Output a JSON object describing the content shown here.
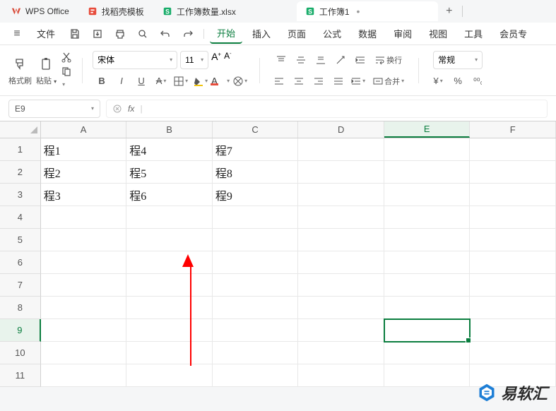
{
  "tabs": {
    "app": "WPS Office",
    "shell": "找稻壳模板",
    "file1": "工作簿数量.xlsx",
    "file2": "工作簿1"
  },
  "menu": {
    "burger": "≡",
    "file": "文件",
    "items": [
      "开始",
      "插入",
      "页面",
      "公式",
      "数据",
      "审阅",
      "视图",
      "工具",
      "会员专"
    ],
    "active": "开始"
  },
  "ribbon": {
    "format_painter": "格式刷",
    "paste": "粘贴",
    "font_name": "宋体",
    "font_size": "11",
    "wrap": "换行",
    "merge": "合并",
    "normal": "常规"
  },
  "name_box": "E9",
  "fx": "fx",
  "columns": [
    "A",
    "B",
    "C",
    "D",
    "E",
    "F"
  ],
  "rows": [
    "1",
    "2",
    "3",
    "4",
    "5",
    "6",
    "7",
    "8",
    "9",
    "10",
    "11"
  ],
  "cells": {
    "A1": "程1",
    "A2": "程2",
    "A3": "程3",
    "B1": "程4",
    "B2": "程5",
    "B3": "程6",
    "C1": "程7",
    "C2": "程8",
    "C3": "程9"
  },
  "selected_cell": "E9",
  "watermark": "易软汇"
}
